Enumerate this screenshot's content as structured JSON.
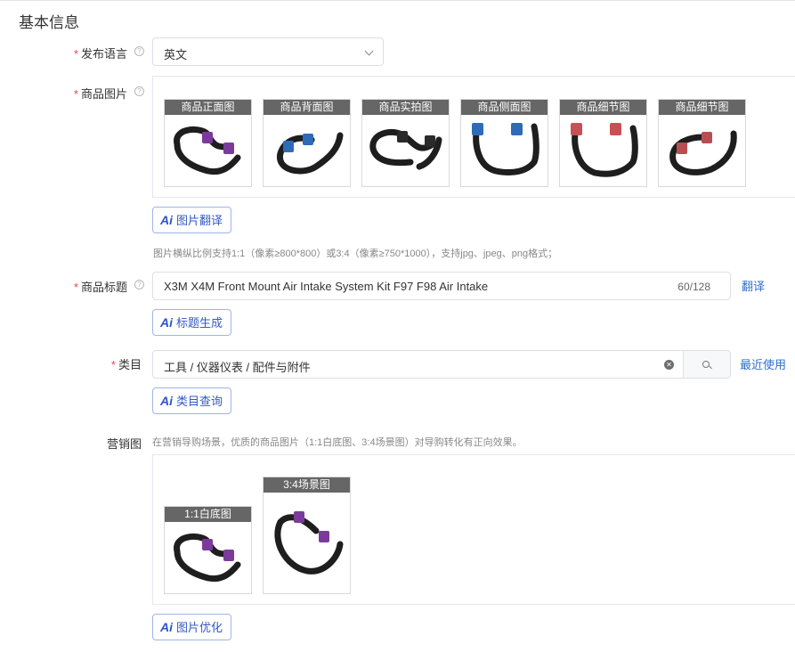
{
  "section": {
    "title": "基本信息"
  },
  "language": {
    "label": "发布语言",
    "value": "英文"
  },
  "product_images": {
    "label": "商品图片",
    "items": [
      {
        "caption": "商品正面图",
        "accent": "#7a3b9a"
      },
      {
        "caption": "商品背面图",
        "accent": "#2d6bb8"
      },
      {
        "caption": "商品实拍图",
        "accent": "#2a2a2a"
      },
      {
        "caption": "商品侧面图",
        "accent": "#2d6bb8"
      },
      {
        "caption": "商品细节图",
        "accent": "#c85055"
      },
      {
        "caption": "商品细节图",
        "accent": "#b84e52"
      }
    ],
    "ai_button": "图片翻译",
    "hint": "图片横纵比例支持1:1（像素≥800*800）或3:4（像素≥750*1000），支持jpg、jpeg、png格式；"
  },
  "title_field": {
    "label": "商品标题",
    "value": "X3M X4M Front Mount Air Intake System Kit F97 F98 Air Intake",
    "count": "60/128",
    "translate_link": "翻译",
    "ai_button": "标题生成"
  },
  "category": {
    "label": "类目",
    "value": "工具 / 仪器仪表 / 配件与附件",
    "recent_link": "最近使用",
    "ai_button": "类目查询"
  },
  "marketing": {
    "label": "营销图",
    "hint": "在营销导购场景，优质的商品图片（1:1白底图、3:4场景图）对导购转化有正向效果。",
    "items": [
      {
        "caption": "1:1白底图",
        "accent": "#7a3b9a"
      },
      {
        "caption": "3:4场景图",
        "accent": "#7a3b9a"
      }
    ],
    "ai_button": "图片优化"
  },
  "ai_badge": "Ai",
  "required_mark": "*",
  "colors": {
    "accent": "#3459c5",
    "link": "#2f6fd0",
    "required": "#e5484d",
    "caption_bg": "#666666"
  }
}
